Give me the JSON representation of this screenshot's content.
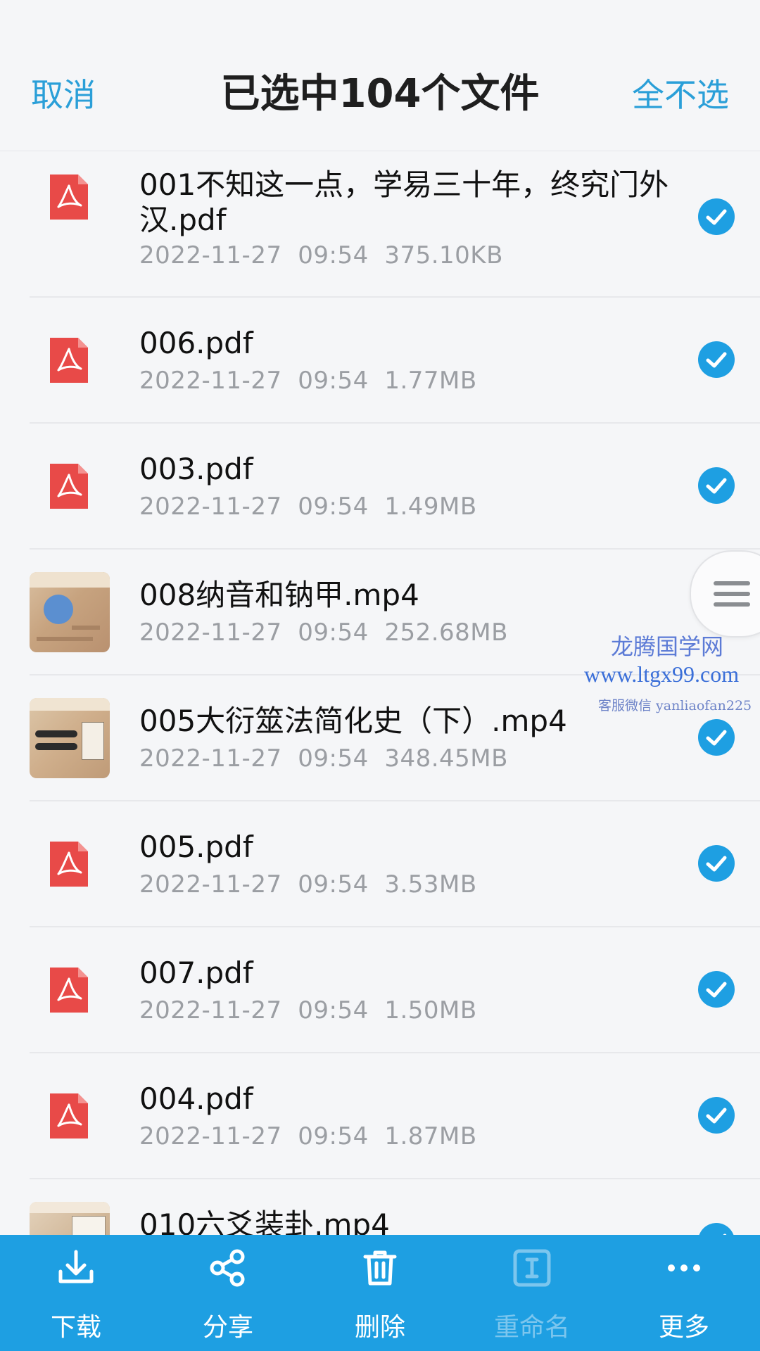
{
  "header": {
    "cancel_label": "取消",
    "title": "已选中104个文件",
    "deselect_all_label": "全不选"
  },
  "files": [
    {
      "name": "001不知这一点，学易三十年，终究门外汉.pdf",
      "date": "2022-11-27",
      "time": "09:54",
      "size": "375.10KB",
      "type": "pdf",
      "selected": true
    },
    {
      "name": "006.pdf",
      "date": "2022-11-27",
      "time": "09:54",
      "size": "1.77MB",
      "type": "pdf",
      "selected": true
    },
    {
      "name": "003.pdf",
      "date": "2022-11-27",
      "time": "09:54",
      "size": "1.49MB",
      "type": "pdf",
      "selected": true
    },
    {
      "name": "008纳音和钠甲.mp4",
      "date": "2022-11-27",
      "time": "09:54",
      "size": "252.68MB",
      "type": "mp4",
      "selected": true
    },
    {
      "name": "005大衍筮法简化史（下）.mp4",
      "date": "2022-11-27",
      "time": "09:54",
      "size": "348.45MB",
      "type": "mp4",
      "selected": true
    },
    {
      "name": "005.pdf",
      "date": "2022-11-27",
      "time": "09:54",
      "size": "3.53MB",
      "type": "pdf",
      "selected": true
    },
    {
      "name": "007.pdf",
      "date": "2022-11-27",
      "time": "09:54",
      "size": "1.50MB",
      "type": "pdf",
      "selected": true
    },
    {
      "name": "004.pdf",
      "date": "2022-11-27",
      "time": "09:54",
      "size": "1.87MB",
      "type": "pdf",
      "selected": true
    },
    {
      "name": "010六爻装卦.mp4",
      "type": "mp4",
      "selected": true
    }
  ],
  "watermark": {
    "line1": "龙腾国学网",
    "line2": "www.ltgx99.com",
    "line3": "客服微信 yanliaofan225"
  },
  "toolbar": {
    "download_label": "下载",
    "share_label": "分享",
    "delete_label": "删除",
    "rename_label": "重命名",
    "more_label": "更多"
  },
  "colors": {
    "accent": "#2a9fd8",
    "toolbar_bg": "#1e9fe2",
    "pdf_red": "#e84a48",
    "check_blue": "#1e9fe2"
  }
}
